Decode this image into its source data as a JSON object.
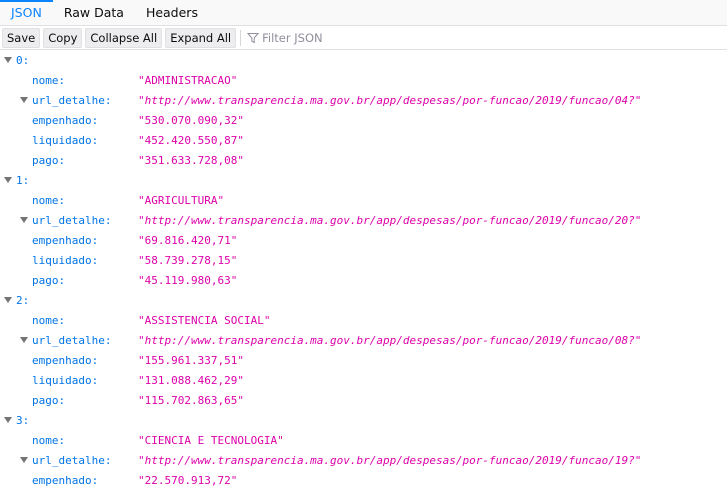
{
  "tabs": [
    {
      "label": "JSON",
      "active": true
    },
    {
      "label": "Raw Data",
      "active": false
    },
    {
      "label": "Headers",
      "active": false
    }
  ],
  "toolbar": {
    "save": "Save",
    "copy": "Copy",
    "collapse_all": "Collapse All",
    "expand_all": "Expand All",
    "filter_placeholder": "Filter JSON",
    "filter_icon": "filter-icon"
  },
  "colors": {
    "key": "#0074e8",
    "string": "#dd00a9",
    "accent": "#0a84ff"
  },
  "items": [
    {
      "index": "0:",
      "nome_key": "nome:",
      "nome": "\"ADMINISTRACAO\"",
      "url_key": "url_detalhe:",
      "url": "\"http://www.transparencia.ma.gov.br/app/despesas/por-funcao/2019/funcao/04?\"",
      "emp_key": "empenhado:",
      "empenhado": "\"530.070.090,32\"",
      "liq_key": "liquidado:",
      "liquidado": "\"452.420.550,87\"",
      "pago_key": "pago:",
      "pago": "\"351.633.728,08\""
    },
    {
      "index": "1:",
      "nome_key": "nome:",
      "nome": "\"AGRICULTURA\"",
      "url_key": "url_detalhe:",
      "url": "\"http://www.transparencia.ma.gov.br/app/despesas/por-funcao/2019/funcao/20?\"",
      "emp_key": "empenhado:",
      "empenhado": "\"69.816.420,71\"",
      "liq_key": "liquidado:",
      "liquidado": "\"58.739.278,15\"",
      "pago_key": "pago:",
      "pago": "\"45.119.980,63\""
    },
    {
      "index": "2:",
      "nome_key": "nome:",
      "nome": "\"ASSISTENCIA SOCIAL\"",
      "url_key": "url_detalhe:",
      "url": "\"http://www.transparencia.ma.gov.br/app/despesas/por-funcao/2019/funcao/08?\"",
      "emp_key": "empenhado:",
      "empenhado": "\"155.961.337,51\"",
      "liq_key": "liquidado:",
      "liquidado": "\"131.088.462,29\"",
      "pago_key": "pago:",
      "pago": "\"115.702.863,65\""
    },
    {
      "index": "3:",
      "nome_key": "nome:",
      "nome": "\"CIENCIA E TECNOLOGIA\"",
      "url_key": "url_detalhe:",
      "url": "\"http://www.transparencia.ma.gov.br/app/despesas/por-funcao/2019/funcao/19?\"",
      "emp_key": "empenhado:",
      "empenhado": "\"22.570.913,72\""
    }
  ]
}
